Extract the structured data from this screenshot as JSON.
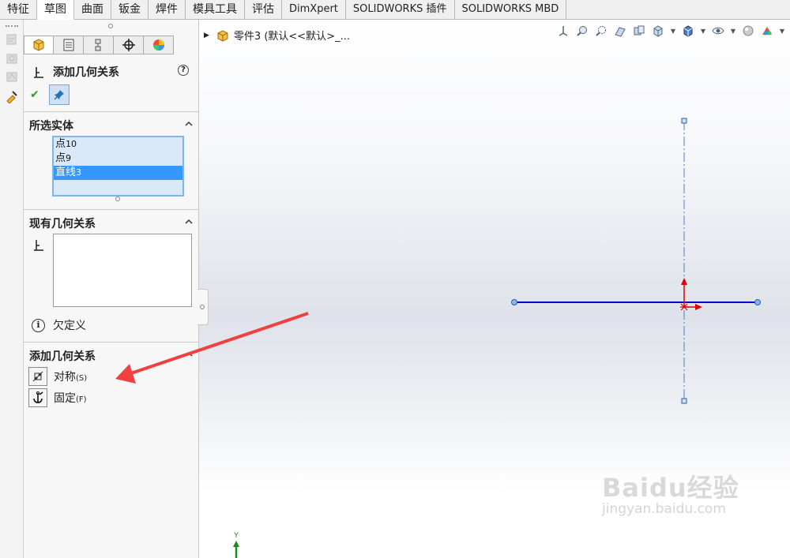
{
  "menu_tabs": [
    "特征",
    "草图",
    "曲面",
    "钣金",
    "焊件",
    "模具工具",
    "评估",
    "DimXpert",
    "SOLIDWORKS 插件",
    "SOLIDWORKS MBD"
  ],
  "active_tab_index": 1,
  "property_manager": {
    "tab_icons": [
      "feature-manager-icon",
      "property-manager-icon",
      "configuration-manager-icon",
      "dimxpert-manager-icon",
      "display-manager-icon"
    ],
    "title": "添加几何关系",
    "help_symbol": "?",
    "ok_symbol": "✔",
    "selected_entities": {
      "heading": "所选实体",
      "items": [
        {
          "name": "点",
          "index": "10",
          "selected": false
        },
        {
          "name": "点",
          "index": "9",
          "selected": false
        },
        {
          "name": "直线",
          "index": "3",
          "selected": true
        }
      ]
    },
    "existing_relations": {
      "heading": "现有几何关系",
      "status_text": "欠定义"
    },
    "add_relations": {
      "heading": "添加几何关系",
      "items": [
        {
          "label": "对称",
          "shortcut": "(S)"
        },
        {
          "label": "固定",
          "shortcut": "(F)"
        }
      ]
    }
  },
  "feature_tree": {
    "part_label": "零件3 (默认<<默认>_..."
  },
  "view_toolbar_icons": [
    "zoom-to-fit-icon",
    "zoom-to-area-icon",
    "previous-view-icon",
    "section-view-icon",
    "dynamic-annotation-view-icon",
    "view-orientation-icon",
    "display-style-icon",
    "hide-show-items-icon",
    "edit-appearance-icon",
    "apply-scene-icon"
  ],
  "sketch": {
    "y_axis_label": "Y",
    "colors": {
      "line": "#0000cc",
      "centerline": "#4a7fd4",
      "origin": "#e00000",
      "point": "#8ab4f0",
      "y_axis": "#1a8a1a"
    }
  },
  "watermark": {
    "title": "Baidu经验",
    "url": "jingyan.baidu.com"
  }
}
